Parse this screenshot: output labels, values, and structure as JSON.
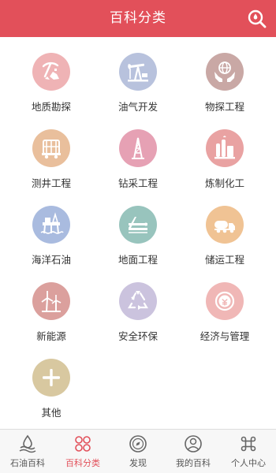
{
  "header": {
    "title": "百科分类",
    "background": "#e2505a"
  },
  "categories": [
    {
      "label": "地质勘探",
      "icon": "mining-pickaxe-icon",
      "color": "#efb3b5"
    },
    {
      "label": "油气开发",
      "icon": "oil-pump-jack-icon",
      "color": "#b8c2dd"
    },
    {
      "label": "物探工程",
      "icon": "globe-in-hands-icon",
      "color": "#c9a8a5"
    },
    {
      "label": "测井工程",
      "icon": "logging-truck-icon",
      "color": "#e9bf9c"
    },
    {
      "label": "钻采工程",
      "icon": "drilling-derrick-icon",
      "color": "#e6a1b4"
    },
    {
      "label": "炼制化工",
      "icon": "refinery-plant-icon",
      "color": "#e9a2a2"
    },
    {
      "label": "海洋石油",
      "icon": "offshore-platform-icon",
      "color": "#a9bbdf"
    },
    {
      "label": "地面工程",
      "icon": "surface-pipeline-icon",
      "color": "#98c4bd"
    },
    {
      "label": "储运工程",
      "icon": "tanker-truck-icon",
      "color": "#f0c394"
    },
    {
      "label": "新能源",
      "icon": "wind-turbine-icon",
      "color": "#dba09d"
    },
    {
      "label": "安全环保",
      "icon": "recycle-icon",
      "color": "#cbc3de"
    },
    {
      "label": "经济与管理",
      "icon": "currency-coin-icon",
      "color": "#f0b7b6"
    },
    {
      "label": "其他",
      "icon": "plus-icon",
      "color": "#d8c8a0"
    }
  ],
  "tabs": [
    {
      "label": "石油百科",
      "icon": "oil-drop-icon",
      "active": false
    },
    {
      "label": "百科分类",
      "icon": "category-grid-icon",
      "active": true
    },
    {
      "label": "发现",
      "icon": "compass-icon",
      "active": false
    },
    {
      "label": "我的百科",
      "icon": "user-profile-icon",
      "active": false
    },
    {
      "label": "个人中心",
      "icon": "command-key-icon",
      "active": false
    }
  ],
  "colors": {
    "accent": "#e2505a",
    "tab_inactive": "#555555"
  }
}
